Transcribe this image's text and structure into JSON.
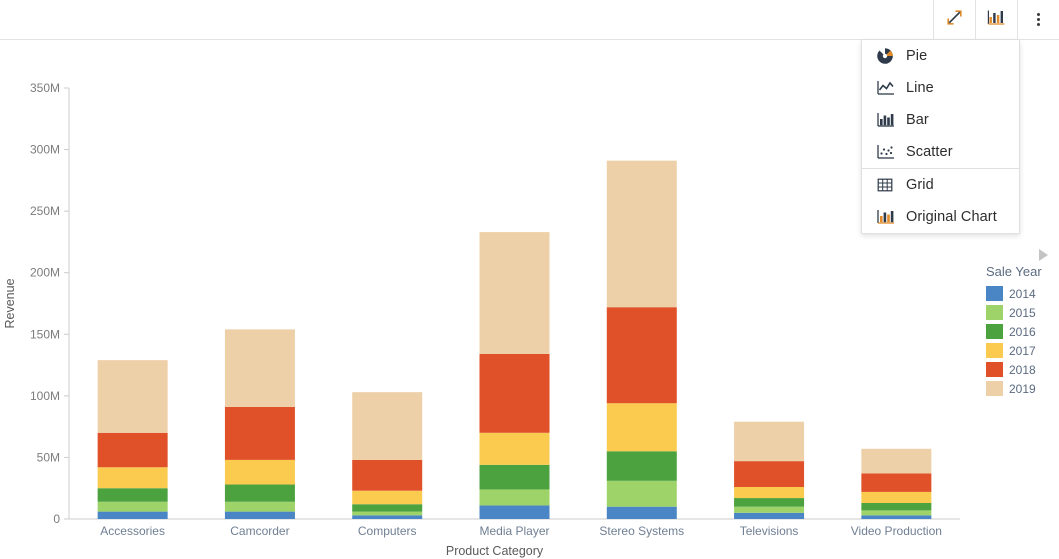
{
  "toolbar": {
    "buttons": [
      {
        "name": "expand-icon",
        "title": "Expand"
      },
      {
        "name": "chart-type-icon",
        "title": "Chart"
      },
      {
        "name": "more-options-icon",
        "title": "More"
      }
    ]
  },
  "menu": {
    "groups": [
      {
        "items": [
          {
            "label": "Pie",
            "icon": "pie-chart-icon"
          },
          {
            "label": "Line",
            "icon": "line-chart-icon"
          },
          {
            "label": "Bar",
            "icon": "bar-chart-icon"
          },
          {
            "label": "Scatter",
            "icon": "scatter-chart-icon"
          }
        ]
      },
      {
        "items": [
          {
            "label": "Grid",
            "icon": "grid-icon"
          },
          {
            "label": "Original Chart",
            "icon": "original-chart-icon"
          }
        ]
      }
    ]
  },
  "legend": {
    "title": "Sale Year",
    "entries": [
      {
        "label": "2014",
        "color": "#4a86c5"
      },
      {
        "label": "2015",
        "color": "#9ed36a"
      },
      {
        "label": "2016",
        "color": "#4ba23f"
      },
      {
        "label": "2017",
        "color": "#fbcb50"
      },
      {
        "label": "2018",
        "color": "#e0512a"
      },
      {
        "label": "2019",
        "color": "#eed0a8"
      }
    ]
  },
  "chart_data": {
    "type": "bar",
    "subtype": "stacked-bar",
    "title": "",
    "xlabel": "Product Category",
    "ylabel": "Revenue",
    "ylim": [
      0,
      350000000
    ],
    "ytick_labels": [
      "0",
      "50M",
      "100M",
      "150M",
      "200M",
      "250M",
      "300M",
      "350M"
    ],
    "ytick_values": [
      0,
      50000000,
      100000000,
      150000000,
      200000000,
      250000000,
      300000000,
      350000000
    ],
    "grid": false,
    "legend_position": "right",
    "categories": [
      "Accessories",
      "Camcorder",
      "Computers",
      "Media Player",
      "Stereo Systems",
      "Televisions",
      "Video Production"
    ],
    "series": [
      {
        "name": "2014",
        "color": "#4a86c5",
        "values": [
          6000000,
          6000000,
          3000000,
          11000000,
          10000000,
          5000000,
          3000000
        ]
      },
      {
        "name": "2015",
        "color": "#9ed36a",
        "values": [
          8000000,
          8000000,
          3000000,
          13000000,
          21000000,
          5000000,
          4000000
        ]
      },
      {
        "name": "2016",
        "color": "#4ba23f",
        "values": [
          11000000,
          14000000,
          6000000,
          20000000,
          24000000,
          7000000,
          6000000
        ]
      },
      {
        "name": "2017",
        "color": "#fbcb50",
        "values": [
          17000000,
          20000000,
          11000000,
          26000000,
          39000000,
          9000000,
          9000000
        ]
      },
      {
        "name": "2018",
        "color": "#e0512a",
        "values": [
          28000000,
          43000000,
          25000000,
          64000000,
          78000000,
          21000000,
          15000000
        ]
      },
      {
        "name": "2019",
        "color": "#eed0a8",
        "values": [
          59000000,
          63000000,
          55000000,
          99000000,
          119000000,
          32000000,
          20000000
        ]
      }
    ],
    "totals": [
      129000000,
      154000000,
      103000000,
      246000000,
      291000000,
      79000000,
      57000000
    ]
  }
}
